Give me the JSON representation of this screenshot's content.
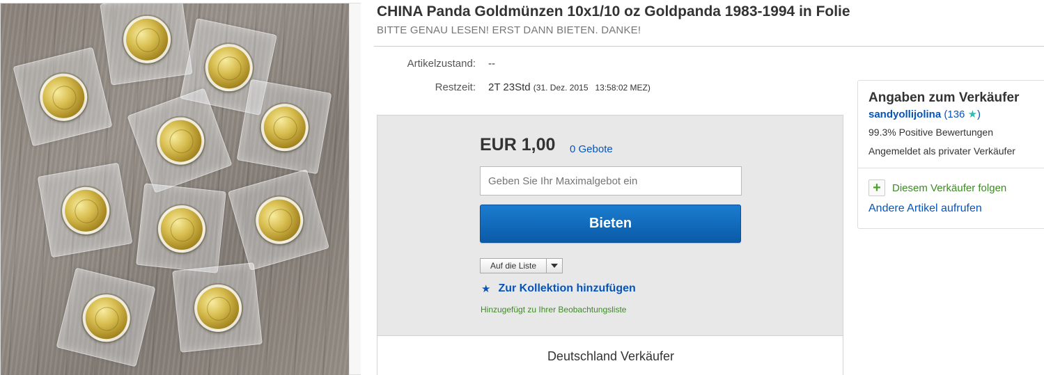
{
  "listing": {
    "title": "CHINA Panda Goldmünzen 10x1/10 oz Goldpanda 1983-1994 in Folie",
    "subtitle": "BITTE GENAU LESEN! ERST DANN BIETEN. DANKE!"
  },
  "details": {
    "condition_label": "Artikelzustand:",
    "condition_value": "--",
    "time_label": "Restzeit:",
    "time_value": "2T 23Std",
    "time_end": "(31. Dez. 2015   13:58:02 MEZ)"
  },
  "bid": {
    "price": "EUR 1,00",
    "bid_count": "0 Gebote",
    "max_bid_placeholder": "Geben Sie Ihr Maximalgebot ein",
    "bid_button": "Bieten",
    "list_button": "Auf die Liste",
    "collection_link": "Zur Kollektion hinzufügen",
    "watch_note": "Hinzugefügt zu Ihrer Beobachtungsliste",
    "seller_location": "Deutschland Verkäufer"
  },
  "seller": {
    "heading": "Angaben zum Verkäufer",
    "name": "sandyollijolina",
    "score_open": "(",
    "score": "136",
    "score_close": ")",
    "feedback": "99.3% Positive Bewertungen",
    "type": "Angemeldet als privater Verkäufer",
    "follow": "Diesem Verkäufer folgen",
    "other_items": "Andere Artikel aufrufen"
  },
  "photo": {
    "subject": "gold panda coins in plastic sleeves on wooden surface",
    "coin_count": 10
  },
  "colors": {
    "link_blue": "#0654ba",
    "bid_button": "#0a5ba8",
    "green_note": "#3d8a25",
    "star_teal": "#2ebcae"
  },
  "icons": {
    "collection": "star-icon",
    "seller_star": "teal-star-icon",
    "follow": "plus-icon",
    "list_dropdown": "caret-down-icon"
  }
}
